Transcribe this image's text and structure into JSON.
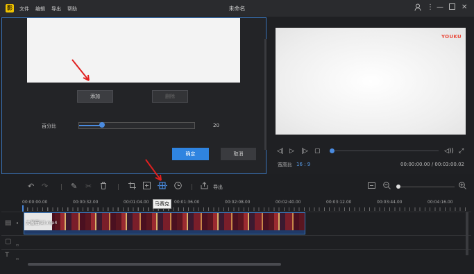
{
  "titlebar": {
    "menus": [
      "文件",
      "编辑",
      "导出",
      "帮助"
    ],
    "title": "未命名"
  },
  "editor": {
    "add_label": "添加",
    "delete_label": "删除",
    "percent_label": "百分比",
    "percent_value": "20",
    "slider_fraction": 0.2,
    "confirm_label": "确定",
    "cancel_label": "取消"
  },
  "preview": {
    "watermark": "YOUKU",
    "aspect_label": "宽高比",
    "aspect_value": "16 : 9",
    "time": "00:00:00.00 / 00:03:00.02",
    "progress_fraction": 0
  },
  "toolbar": {
    "export_label": "导出",
    "tooltip": "马赛克",
    "active_tool": "mosaic-icon"
  },
  "timeline": {
    "ruler": [
      "00:00:00.00",
      "00:00:32.00",
      "00:01:04.00",
      "00:01:36.00",
      "00:02:08.00",
      "00:02:40.00",
      "00:03:12.00",
      "00:03:44.00",
      "00:04:16.00"
    ],
    "clip_name": "大蕃茄(2).mp4"
  },
  "colors": {
    "accent": "#2f84e0",
    "arrow": "#e02020",
    "background": "#1e1f22"
  }
}
